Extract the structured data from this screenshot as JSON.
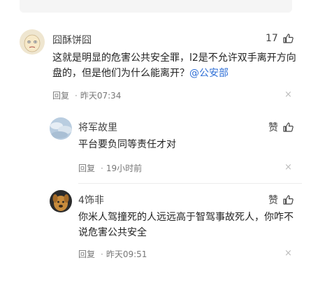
{
  "comments": [
    {
      "username": "囧酥饼囧",
      "likes": "17",
      "text_main": "这就是明显的危害公共安全罪，l2是不允许双手离开方向盘的，但是他们为什么能离开？",
      "mention": "@公安部",
      "reply_label": "回复",
      "separator": "·",
      "time": "昨天07:34",
      "close_glyph": "×",
      "avatar_icon": "cartoon-face-icon"
    },
    {
      "username": "将军故里",
      "likes": "赞",
      "text_main": "平台要负同等责任才对",
      "reply_label": "回复",
      "separator": "·",
      "time": "19小时前",
      "close_glyph": "×",
      "avatar_icon": "sky-photo-icon"
    },
    {
      "username": "4饰非",
      "likes": "赞",
      "text_main": "你米人驾撞死的人远远高于智驾事故死人，你咋不说危害公共安全",
      "reply_label": "回复",
      "separator": "·",
      "time": "昨天09:51",
      "close_glyph": "×",
      "avatar_icon": "dog-photo-icon"
    }
  ]
}
